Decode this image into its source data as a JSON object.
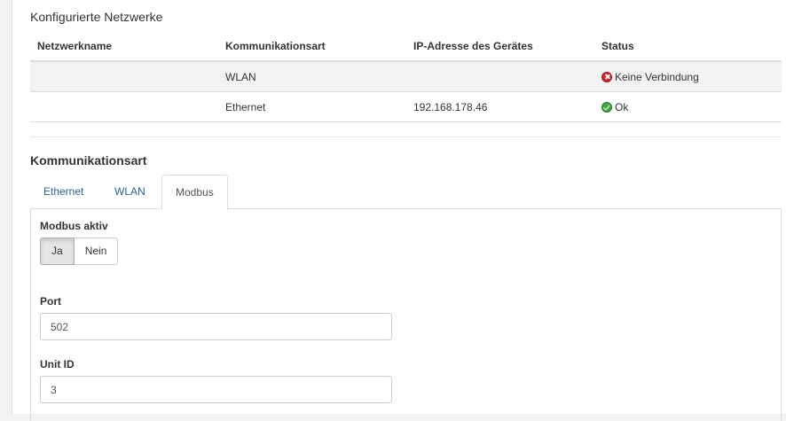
{
  "configured_networks": {
    "title": "Konfigurierte Netzwerke",
    "columns": [
      "Netzwerkname",
      "Kommunikationsart",
      "IP-Adresse des Gerätes",
      "Status"
    ],
    "rows": [
      {
        "name": "",
        "type": "WLAN",
        "ip": "",
        "status": "Keine Verbindung",
        "status_icon": "error-icon"
      },
      {
        "name": "",
        "type": "Ethernet",
        "ip": "192.168.178.46",
        "status": "Ok",
        "status_icon": "ok-icon"
      }
    ]
  },
  "communication": {
    "title": "Kommunikationsart",
    "tabs": [
      {
        "label": "Ethernet",
        "active": false
      },
      {
        "label": "WLAN",
        "active": false
      },
      {
        "label": "Modbus",
        "active": true
      }
    ],
    "modbus": {
      "active_label": "Modbus aktiv",
      "yes_label": "Ja",
      "no_label": "Nein",
      "selected": "Ja",
      "port_label": "Port",
      "port_value": "502",
      "unit_id_label": "Unit ID",
      "unit_id_value": "3"
    }
  },
  "colors": {
    "link": "#2a6496",
    "error": "#d9242b",
    "ok": "#3fa83a",
    "row_stripe": "#f2f2f2"
  }
}
